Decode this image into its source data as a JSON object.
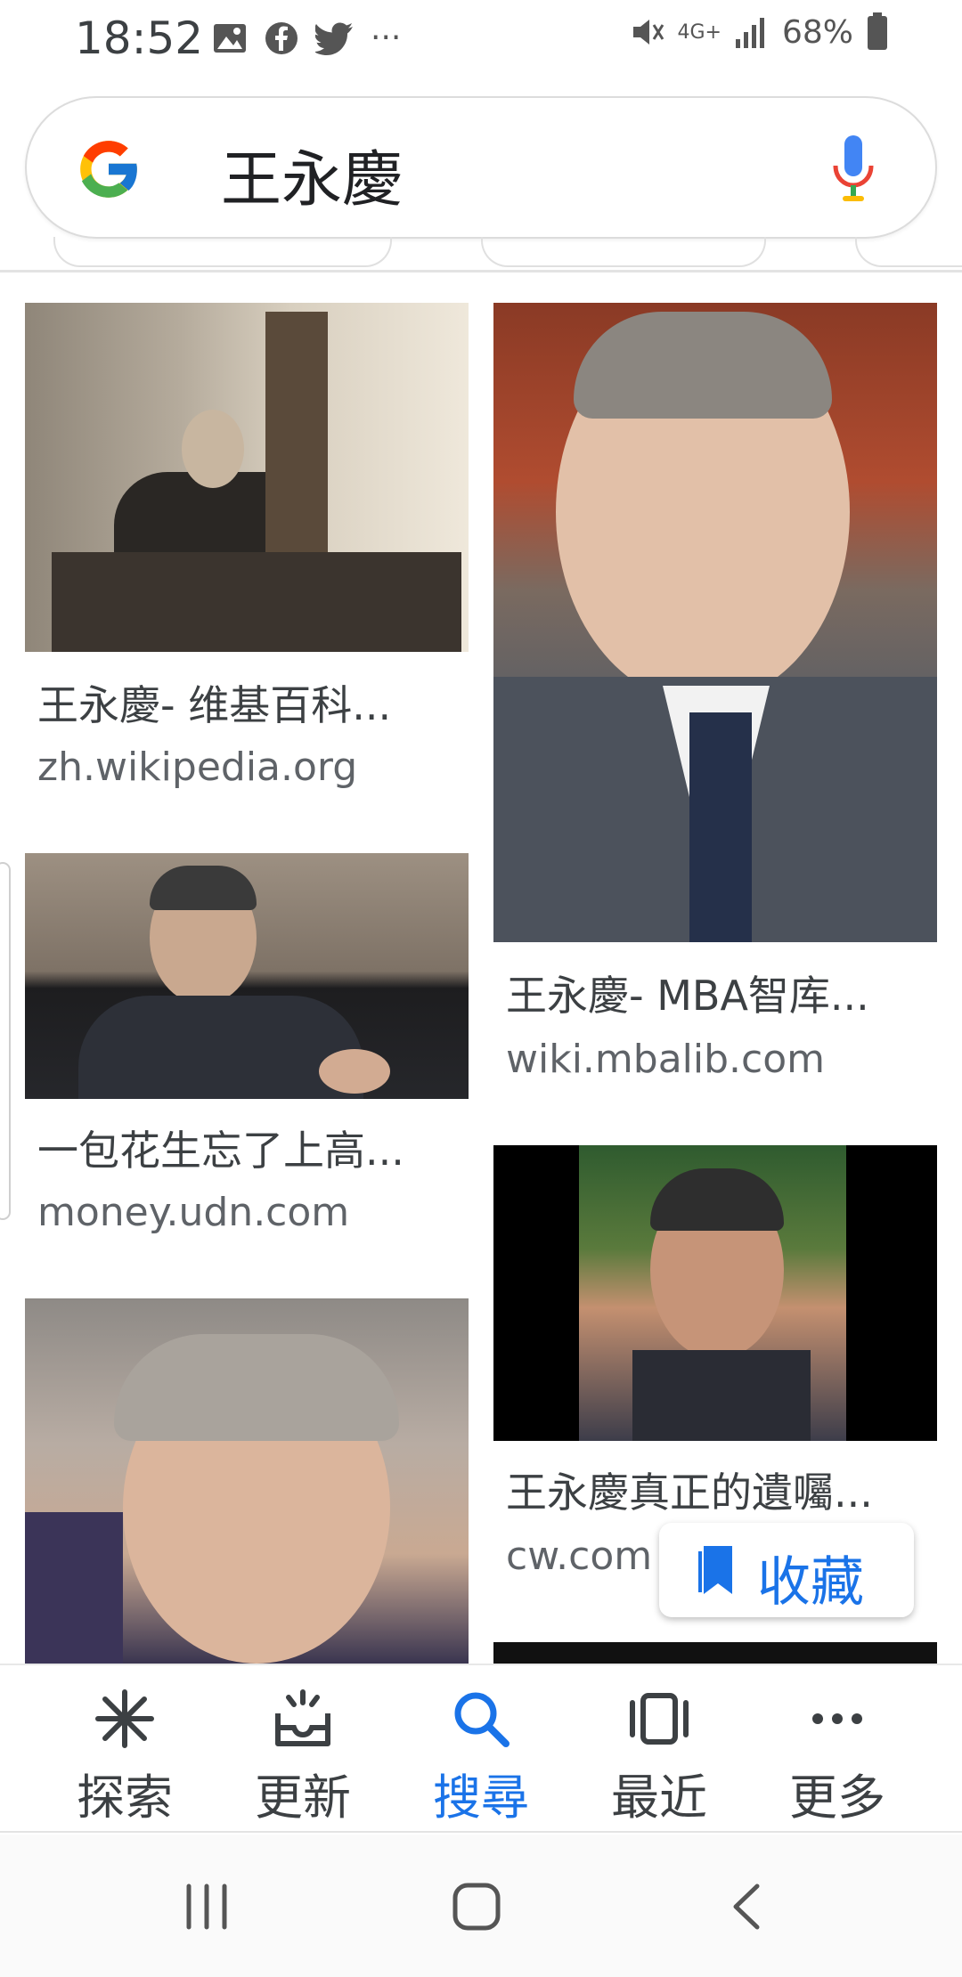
{
  "status_bar": {
    "time": "18:52",
    "battery": "68%",
    "network": "4G+",
    "left_icons": [
      "image-icon",
      "facebook-icon",
      "twitter-icon",
      "more-dots-icon"
    ],
    "right_icons": [
      "mute-icon",
      "network-icon",
      "signal-icon",
      "battery-icon"
    ]
  },
  "search": {
    "query": "王永慶"
  },
  "results": [
    {
      "title": "王永慶- 维基百科...",
      "source": "zh.wikipedia.org"
    },
    {
      "title": "王永慶- MBA智库...",
      "source": "wiki.mbalib.com"
    },
    {
      "title": "一包花生忘了上高...",
      "source": "money.udn.com"
    },
    {
      "title": "王永慶真正的遺囑...",
      "source": "cw.com"
    }
  ],
  "save_button": {
    "label": "收藏"
  },
  "bottom_nav": {
    "items": [
      {
        "label": "探索",
        "icon": "asterisk-icon"
      },
      {
        "label": "更新",
        "icon": "updates-tray-icon"
      },
      {
        "label": "搜尋",
        "icon": "search-icon"
      },
      {
        "label": "最近",
        "icon": "recent-tabs-icon"
      },
      {
        "label": "更多",
        "icon": "more-horizontal-icon"
      }
    ],
    "active": "搜尋"
  },
  "colors": {
    "accent": "#1a73e8",
    "text": "#3c4043",
    "secondary_text": "#5f6368"
  }
}
